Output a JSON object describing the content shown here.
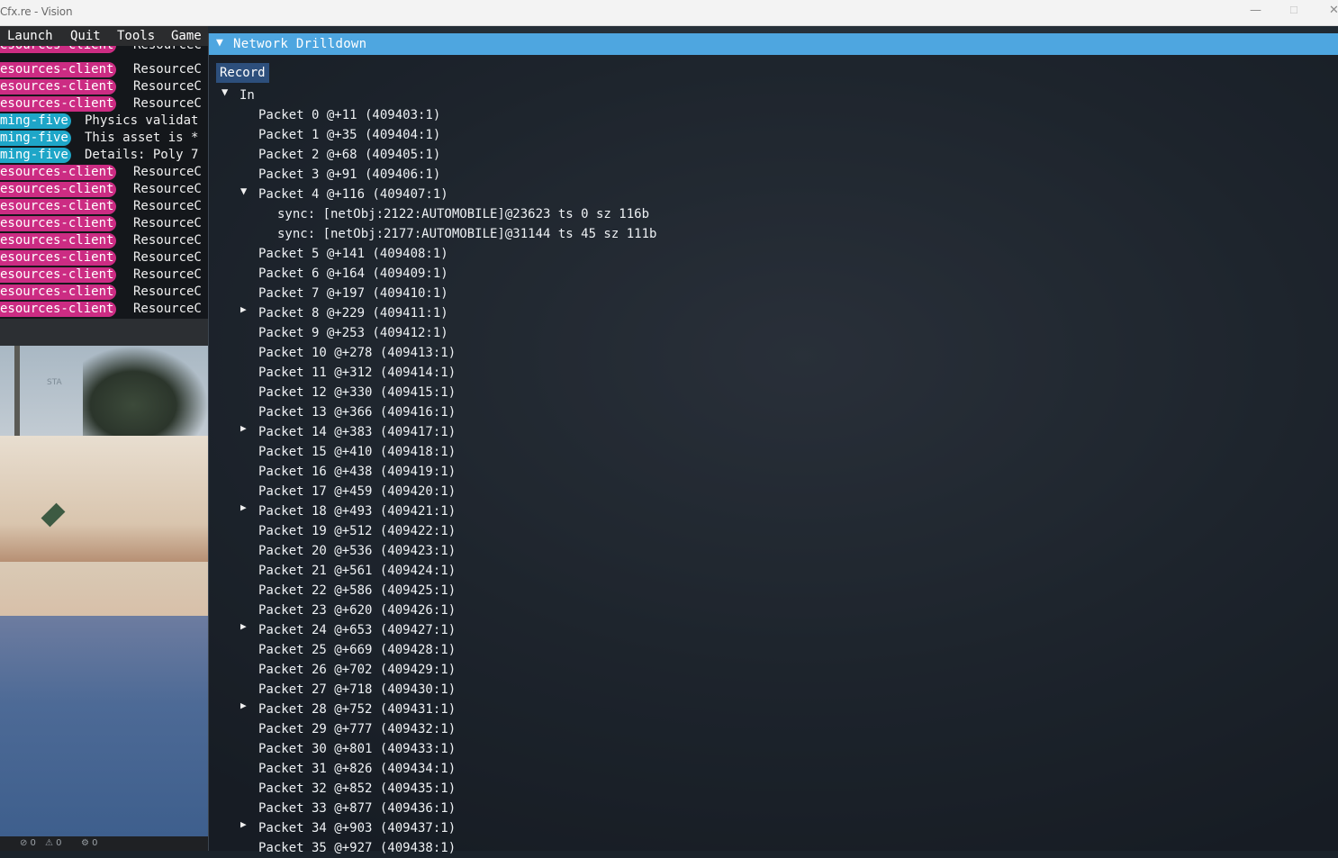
{
  "window": {
    "title": "Cfx.re - Vision",
    "controls": {
      "minimize": "—",
      "maximize": "☐",
      "close": "✕"
    }
  },
  "menu": [
    "Launch",
    "Quit",
    "Tools",
    "Game"
  ],
  "log": [
    {
      "tag": "esources-client",
      "tag_color": "pink",
      "message": "ResourceC"
    },
    {
      "tag": "esources-client",
      "tag_color": "pink",
      "message": "ResourceC"
    },
    {
      "tag": "esources-client",
      "tag_color": "pink",
      "message": "ResourceC"
    },
    {
      "tag": "ming-five",
      "tag_color": "cyan",
      "message": "Physics validat"
    },
    {
      "tag": "ming-five",
      "tag_color": "cyan",
      "message": "This asset is *"
    },
    {
      "tag": "ming-five",
      "tag_color": "cyan",
      "message": "Details: Poly 7"
    },
    {
      "tag": "esources-client",
      "tag_color": "pink",
      "message": "ResourceC"
    },
    {
      "tag": "esources-client",
      "tag_color": "pink",
      "message": "ResourceC"
    },
    {
      "tag": "esources-client",
      "tag_color": "pink",
      "message": "ResourceC"
    },
    {
      "tag": "esources-client",
      "tag_color": "pink",
      "message": "ResourceC"
    },
    {
      "tag": "esources-client",
      "tag_color": "pink",
      "message": "ResourceC"
    },
    {
      "tag": "esources-client",
      "tag_color": "pink",
      "message": "ResourceC"
    },
    {
      "tag": "esources-client",
      "tag_color": "pink",
      "message": "ResourceC"
    },
    {
      "tag": "esources-client",
      "tag_color": "pink",
      "message": "ResourceC"
    },
    {
      "tag": "esources-client",
      "tag_color": "pink",
      "message": "ResourceC"
    }
  ],
  "log_partial_top": {
    "tag": "esources-client",
    "message": "ResourceC"
  },
  "scene": {
    "sign_text": "STA"
  },
  "status_bar": [
    "⊘ 0",
    "⚠ 0",
    "⚙ 0"
  ],
  "colors": {
    "header": "#4ea6e0",
    "record_button": "#2d4f7c",
    "tag_pink": "#cc2c83",
    "tag_cyan": "#1ea6c8"
  },
  "panel": {
    "title": "Network Drilldown",
    "record_label": "Record",
    "root": {
      "label": "In",
      "expanded": true
    },
    "packets": [
      {
        "label": "Packet 0 @+11 (409403:1)",
        "has_children": false
      },
      {
        "label": "Packet 1 @+35 (409404:1)",
        "has_children": false
      },
      {
        "label": "Packet 2 @+68 (409405:1)",
        "has_children": false
      },
      {
        "label": "Packet 3 @+91 (409406:1)",
        "has_children": false
      },
      {
        "label": "Packet 4 @+116 (409407:1)",
        "has_children": true,
        "expanded": true,
        "children": [
          "sync: [netObj:2122:AUTOMOBILE]@23623 ts 0 sz 116b",
          "sync: [netObj:2177:AUTOMOBILE]@31144 ts 45 sz 111b"
        ]
      },
      {
        "label": "Packet 5 @+141 (409408:1)",
        "has_children": false
      },
      {
        "label": "Packet 6 @+164 (409409:1)",
        "has_children": false
      },
      {
        "label": "Packet 7 @+197 (409410:1)",
        "has_children": false
      },
      {
        "label": "Packet 8 @+229 (409411:1)",
        "has_children": true,
        "expanded": false
      },
      {
        "label": "Packet 9 @+253 (409412:1)",
        "has_children": false
      },
      {
        "label": "Packet 10 @+278 (409413:1)",
        "has_children": false
      },
      {
        "label": "Packet 11 @+312 (409414:1)",
        "has_children": false
      },
      {
        "label": "Packet 12 @+330 (409415:1)",
        "has_children": false
      },
      {
        "label": "Packet 13 @+366 (409416:1)",
        "has_children": false
      },
      {
        "label": "Packet 14 @+383 (409417:1)",
        "has_children": true,
        "expanded": false
      },
      {
        "label": "Packet 15 @+410 (409418:1)",
        "has_children": false
      },
      {
        "label": "Packet 16 @+438 (409419:1)",
        "has_children": false
      },
      {
        "label": "Packet 17 @+459 (409420:1)",
        "has_children": false
      },
      {
        "label": "Packet 18 @+493 (409421:1)",
        "has_children": true,
        "expanded": false
      },
      {
        "label": "Packet 19 @+512 (409422:1)",
        "has_children": false
      },
      {
        "label": "Packet 20 @+536 (409423:1)",
        "has_children": false
      },
      {
        "label": "Packet 21 @+561 (409424:1)",
        "has_children": false
      },
      {
        "label": "Packet 22 @+586 (409425:1)",
        "has_children": false
      },
      {
        "label": "Packet 23 @+620 (409426:1)",
        "has_children": false
      },
      {
        "label": "Packet 24 @+653 (409427:1)",
        "has_children": true,
        "expanded": false
      },
      {
        "label": "Packet 25 @+669 (409428:1)",
        "has_children": false
      },
      {
        "label": "Packet 26 @+702 (409429:1)",
        "has_children": false
      },
      {
        "label": "Packet 27 @+718 (409430:1)",
        "has_children": false
      },
      {
        "label": "Packet 28 @+752 (409431:1)",
        "has_children": true,
        "expanded": false
      },
      {
        "label": "Packet 29 @+777 (409432:1)",
        "has_children": false
      },
      {
        "label": "Packet 30 @+801 (409433:1)",
        "has_children": false
      },
      {
        "label": "Packet 31 @+826 (409434:1)",
        "has_children": false
      },
      {
        "label": "Packet 32 @+852 (409435:1)",
        "has_children": false
      },
      {
        "label": "Packet 33 @+877 (409436:1)",
        "has_children": false
      },
      {
        "label": "Packet 34 @+903 (409437:1)",
        "has_children": true,
        "expanded": false
      },
      {
        "label": "Packet 35 @+927 (409438:1)",
        "has_children": false
      }
    ]
  }
}
